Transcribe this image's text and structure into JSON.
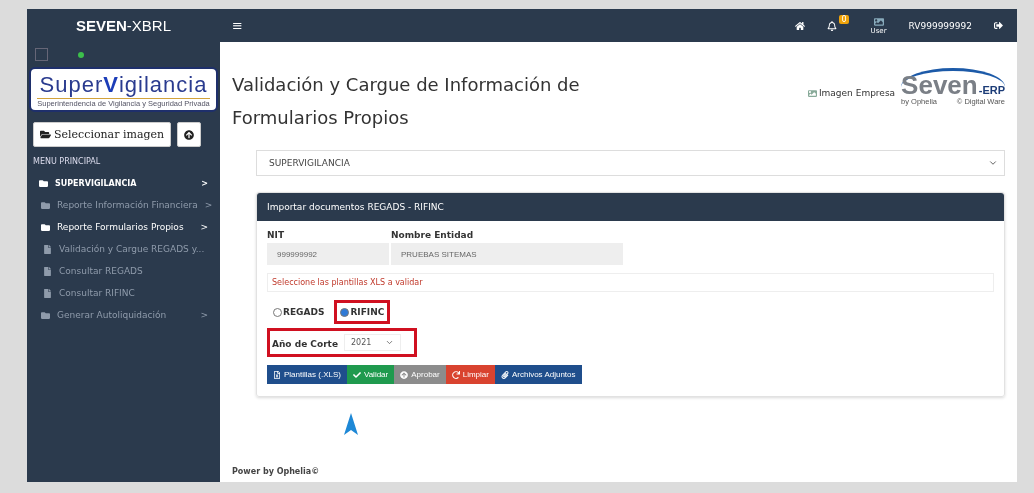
{
  "sidebar": {
    "brand_bold": "SEVEN",
    "brand_rest": "-XBRL",
    "logo": {
      "name_first": "Super",
      "name_v": "V",
      "name_rest": "igilancia",
      "tagline": "Superintendencia de Vigilancia y Seguridad Privada"
    },
    "status_checkbox": {
      "checked": false
    },
    "select_image_button": "Seleccionar imagen",
    "menu_heading": "MENU PRINCIPAL",
    "items": [
      {
        "kind": "folder",
        "label": "SUPERVIGILANCIA",
        "selected": true,
        "caret": ">",
        "children": [
          {
            "kind": "folder",
            "label": "Reporte Información Financiera",
            "selected": false,
            "caret": ">"
          },
          {
            "kind": "folder",
            "label": "Reporte Formularios Propios",
            "selected": true,
            "caret": ">",
            "children": [
              {
                "kind": "file",
                "label": "Validación y Cargue REGADS y...",
                "selected": false
              },
              {
                "kind": "file",
                "label": "Consultar REGADS",
                "selected": false
              },
              {
                "kind": "file",
                "label": "Consultar RIFINC",
                "selected": false
              }
            ]
          },
          {
            "kind": "folder",
            "label": "Generar Autoliquidación",
            "selected": false,
            "caret": ">"
          }
        ]
      }
    ]
  },
  "topbar": {
    "menu_glyph": "≡",
    "notification_count": "0",
    "user_label": "User",
    "username": "RV999999992"
  },
  "page": {
    "title": "Validación y Cargue de Información de Formularios Propios",
    "company_image_alt": "Imagen Empresa",
    "erp_logo": {
      "word": "Seven",
      "suffix": "-ERP",
      "by": "by Ophelia",
      "maker": "© Digital Ware"
    },
    "entity_select": "SUPERVIGILANCIA",
    "panel": {
      "title": "Importar documentos REGADS - RIFINC",
      "nit_label": "NIT",
      "nit_value": "999999992",
      "entity_label": "Nombre Entidad",
      "entity_value": "PRUEBAS SITEMAS",
      "notice": "Seleccione las plantillas XLS a validar",
      "radios": [
        {
          "label": "REGADS",
          "selected": false
        },
        {
          "label": "RIFINC",
          "selected": true
        }
      ],
      "year_label": "Año de Corte",
      "year_value": "2021",
      "buttons": [
        {
          "kind": "templates",
          "label": "Plantillas (.XLS)"
        },
        {
          "kind": "validate",
          "label": "Validar"
        },
        {
          "kind": "approve",
          "label": "Aprobar"
        },
        {
          "kind": "clear",
          "label": "Limpiar"
        },
        {
          "kind": "attachments",
          "label": "Archivos Adjuntos"
        }
      ]
    }
  },
  "footer": "Power by Ophelia©"
}
